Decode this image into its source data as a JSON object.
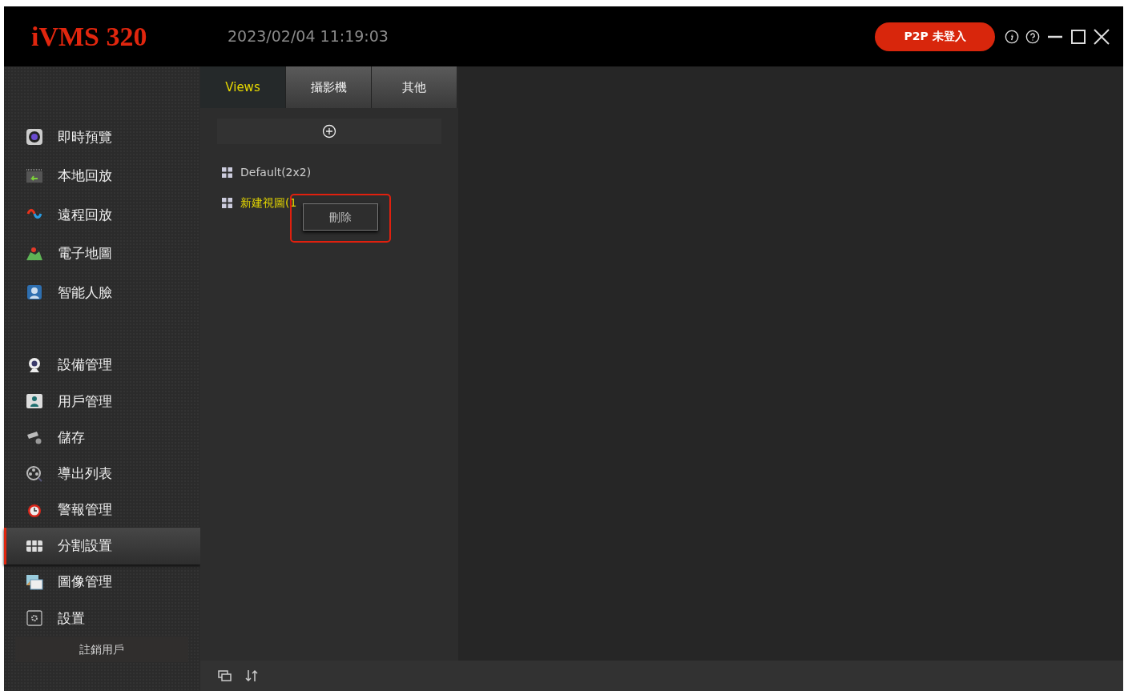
{
  "header": {
    "logo": "iVMS 320",
    "datetime": "2023/02/04 11:19:03",
    "p2p_button": "P2P 未登入"
  },
  "sidebar": {
    "groups": [
      {
        "items": [
          {
            "label": "即時預覽",
            "selected": false
          },
          {
            "label": "本地回放",
            "selected": false
          },
          {
            "label": "遠程回放",
            "selected": false
          },
          {
            "label": "電子地圖",
            "selected": false
          },
          {
            "label": "智能人臉",
            "selected": false
          }
        ]
      },
      {
        "items": [
          {
            "label": "設備管理",
            "selected": false
          },
          {
            "label": "用戶管理",
            "selected": false
          },
          {
            "label": "儲存",
            "selected": false
          },
          {
            "label": "導出列表",
            "selected": false
          },
          {
            "label": "警報管理",
            "selected": false
          },
          {
            "label": "分割設置",
            "selected": true
          },
          {
            "label": "圖像管理",
            "selected": false
          },
          {
            "label": "設置",
            "selected": false
          }
        ]
      }
    ],
    "logout": "註銷用戶"
  },
  "tabs": [
    {
      "label": "Views",
      "selected": true
    },
    {
      "label": "攝影機",
      "selected": false
    },
    {
      "label": "其他",
      "selected": false
    }
  ],
  "views": [
    {
      "label": "Default(2x2)",
      "selected": false
    },
    {
      "label": "新建視圖(1",
      "selected": true
    }
  ],
  "context_menu": {
    "items": [
      "刪除"
    ],
    "highlighted": true
  }
}
